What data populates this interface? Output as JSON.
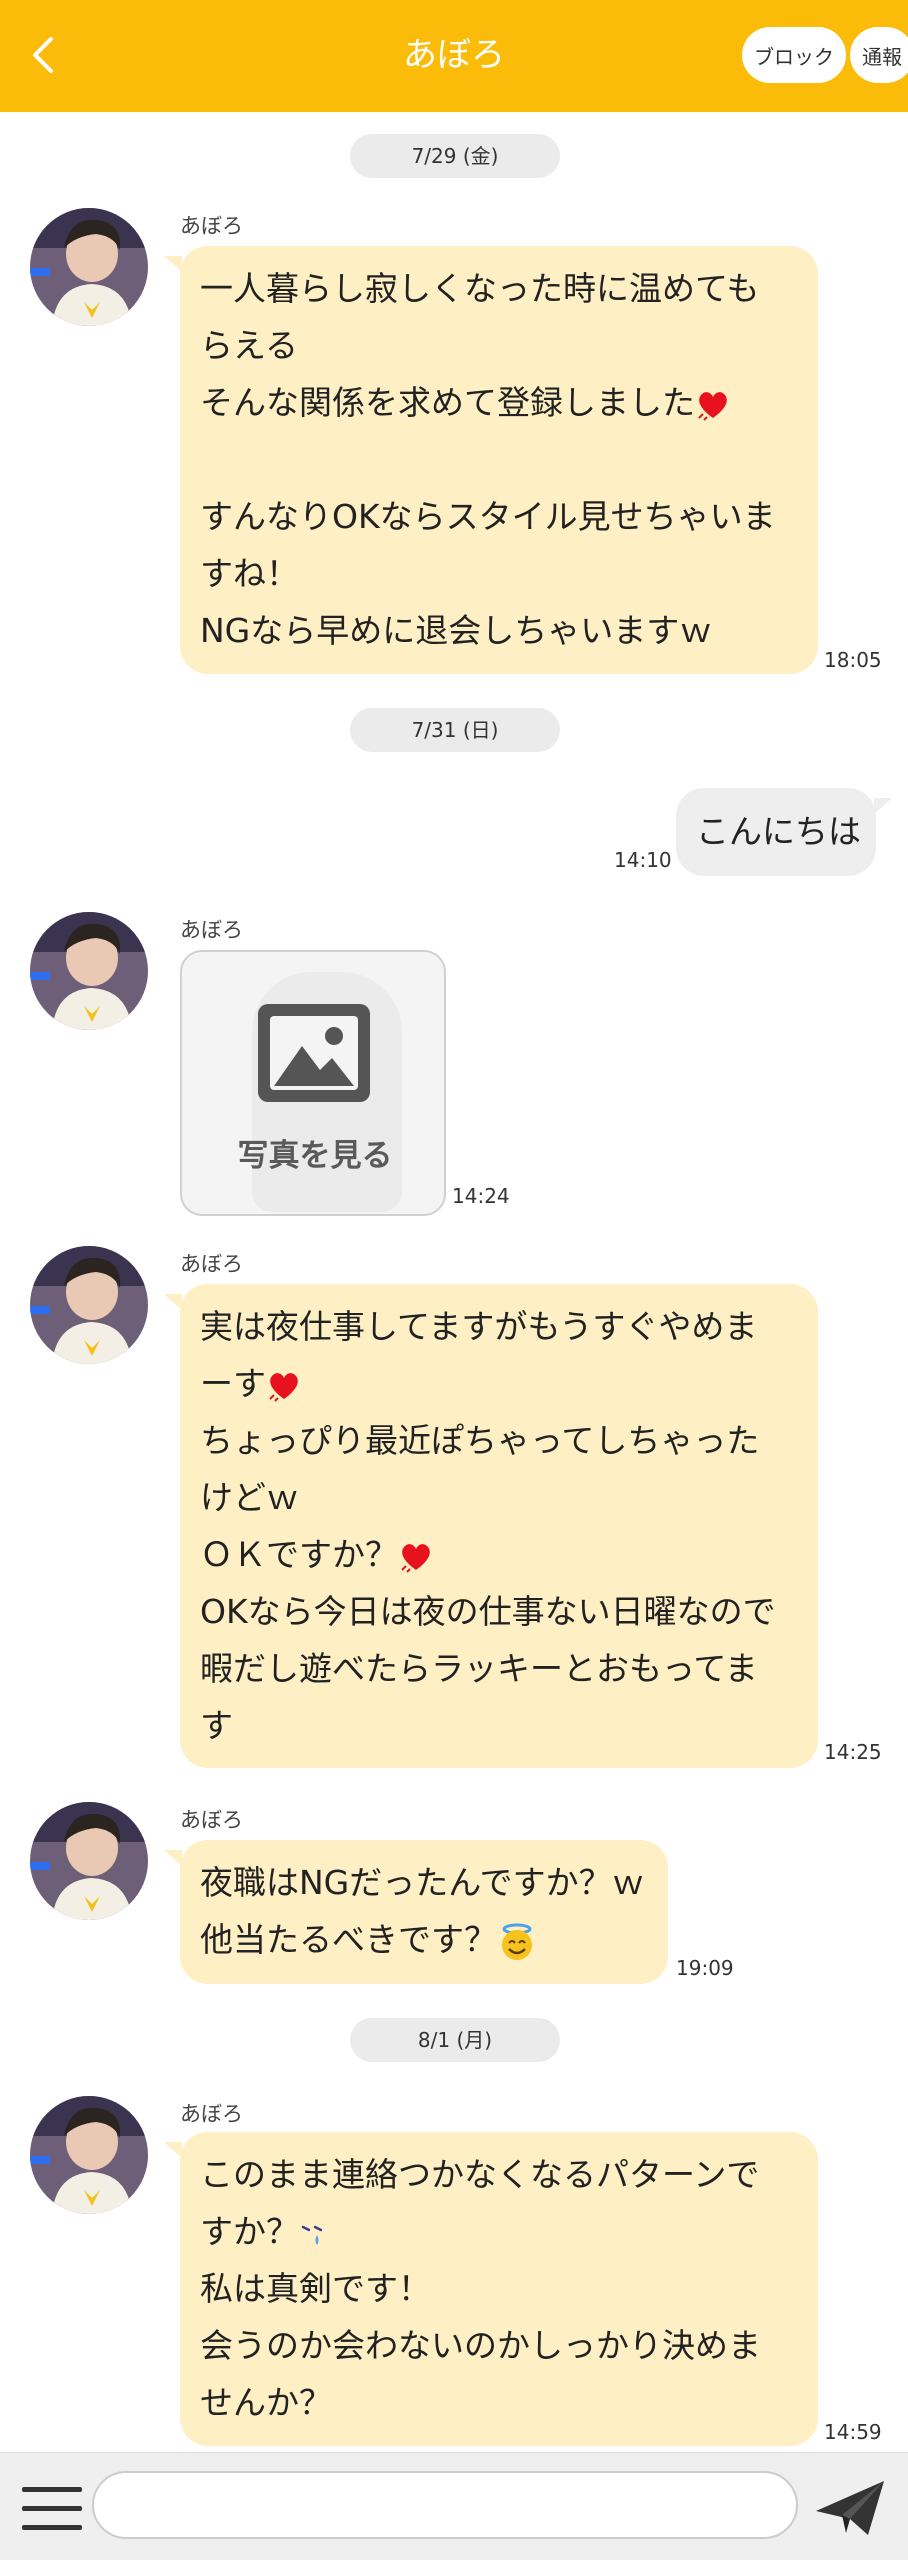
{
  "header": {
    "title": "あぼろ",
    "block_label": "ブロック",
    "report_label": "通報"
  },
  "colors": {
    "header": "#fbbb09",
    "incoming_bubble": "#fef0c4",
    "outgoing_bubble": "#eeeeee",
    "date_pill": "#ebebeb"
  },
  "messages": {
    "date1": "7/29 (金)",
    "m1": {
      "sender": "あぼろ",
      "lines": [
        "一人暮らし寂しくなった時に温めても",
        "らえる",
        "そんな関係を求めて登録しました",
        "",
        "すんなりOKならスタイル見せちゃいま",
        "すね！",
        "NGなら早めに退会しちゃいますｗ"
      ],
      "time": "18:05"
    },
    "date2": "7/31 (日)",
    "m2": {
      "text": "こんにちは",
      "time": "14:10"
    },
    "m3": {
      "sender": "あぼろ",
      "photo_label": "写真を見る",
      "time": "14:24"
    },
    "m4": {
      "sender": "あぼろ",
      "lines": [
        "実は夜仕事してますがもうすぐやめま",
        "ーす",
        "ちょっぴり最近ぽちゃってしちゃった",
        "けどｗ",
        "ＯＫですか？",
        "OKなら今日は夜の仕事ない日曜なので",
        "暇だし遊べたらラッキーとおもってま",
        "す"
      ],
      "time": "14:25"
    },
    "m5": {
      "sender": "あぼろ",
      "lines": [
        "夜職はNGだったんですか？ｗ",
        "他当たるべきです？"
      ],
      "time": "19:09"
    },
    "date3": "8/1 (月)",
    "m6": {
      "sender": "あぼろ",
      "lines": [
        "このまま連絡つかなくなるパターンで",
        "すか？",
        "私は真剣です！",
        "会うのか会わないのかしっかり決めま",
        "せんか？"
      ],
      "time": "14:59"
    }
  },
  "input": {
    "placeholder": ""
  },
  "icons": {
    "back": "chevron-left-icon",
    "menu": "hamburger-menu-icon",
    "send": "paper-plane-send-icon",
    "photo": "image-placeholder-icon",
    "heart": "heart-icon",
    "angel": "smiling-face-with-halo-icon",
    "tear": "crying-face-icon"
  }
}
